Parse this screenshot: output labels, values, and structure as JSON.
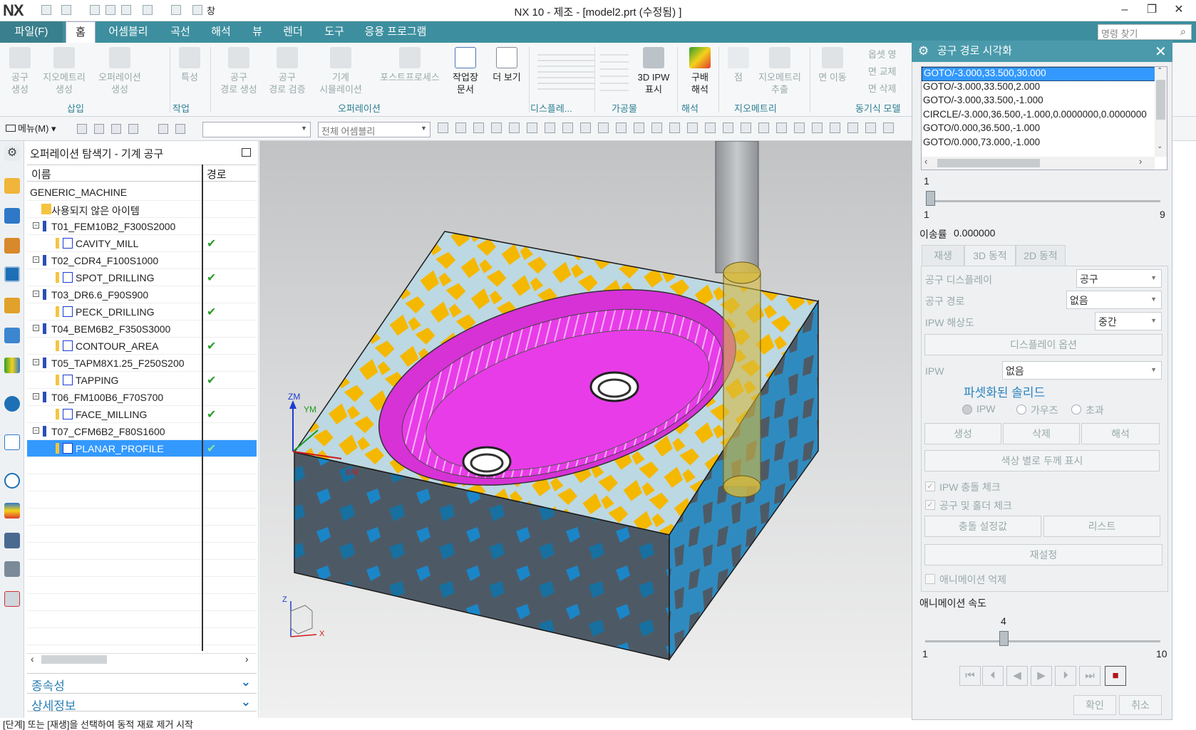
{
  "titlebar": {
    "logo": "NX",
    "window_menu": "창",
    "title": "NX 10 - 제조 - [model2.prt (수정됨) ]"
  },
  "ribbon_tabs": {
    "file": "파일(F)",
    "tabs": [
      "홈",
      "어셈블리",
      "곡선",
      "해석",
      "뷰",
      "렌더",
      "도구",
      "응용 프로그램"
    ],
    "command_search_placeholder": "명령 찾기"
  },
  "ribbon": {
    "insert": {
      "tool_create": "공구\n생성",
      "geometry_create": "지오메트리\n생성",
      "operation_create": "오퍼레이션\n생성",
      "group": "삽입"
    },
    "work": {
      "feature": "특성",
      "group": "작업"
    },
    "operation": {
      "generate_path": "공구\n경로 생성",
      "verify_path": "공구\n경로 검증",
      "machine_sim": "기계\n시뮬레이션",
      "postprocess": "포스트프로세스",
      "shop_doc": "작업장\n문서",
      "more": "더 보기",
      "group": "오퍼레이션"
    },
    "display": {
      "group": "디스플레..."
    },
    "workpiece": {
      "ipw_3d": "3D IPW\n표시",
      "group": "가공물"
    },
    "analysis": {
      "gradient": "구배\n해석",
      "group": "해석"
    },
    "geometry": {
      "point": "점",
      "extract": "지오메트리\n추출",
      "group": "지오메트리"
    },
    "sync": {
      "move_face": "면 이동",
      "offset_area": "옵셋 영",
      "replace_face": "면 교체",
      "delete_face": "면 삭제",
      "group": "동기식 모델"
    }
  },
  "toolbar2": {
    "menu": "메뉴(M)",
    "filter_value": "",
    "assembly_scope": "전체 어셈블리"
  },
  "navigator": {
    "title": "오퍼레이션 탐색기 - 기계 공구",
    "col_name": "이름",
    "col_path": "경로",
    "rows": [
      {
        "label": "GENERIC_MACHINE",
        "level": 0,
        "check": false
      },
      {
        "label": "사용되지 않은 아이템",
        "level": 1,
        "check": false
      },
      {
        "label": "T01_FEM10B2_F300S2000",
        "level": 1,
        "check": false
      },
      {
        "label": "CAVITY_MILL",
        "level": 2,
        "check": true
      },
      {
        "label": "T02_CDR4_F100S1000",
        "level": 1,
        "check": false
      },
      {
        "label": "SPOT_DRILLING",
        "level": 2,
        "check": true
      },
      {
        "label": "T03_DR6.6_F90S900",
        "level": 1,
        "check": false
      },
      {
        "label": "PECK_DRILLING",
        "level": 2,
        "check": true
      },
      {
        "label": "T04_BEM6B2_F350S3000",
        "level": 1,
        "check": false
      },
      {
        "label": "CONTOUR_AREA",
        "level": 2,
        "check": true
      },
      {
        "label": "T05_TAPM8X1.25_F250S200",
        "level": 1,
        "check": false
      },
      {
        "label": "TAPPING",
        "level": 2,
        "check": true
      },
      {
        "label": "T06_FM100B6_F70S700",
        "level": 1,
        "check": false
      },
      {
        "label": "FACE_MILLING",
        "level": 2,
        "check": true
      },
      {
        "label": "T07_CFM6B2_F80S1600",
        "level": 1,
        "check": false
      },
      {
        "label": "PLANAR_PROFILE",
        "level": 2,
        "check": true,
        "selected": true
      }
    ],
    "dependencies": "종속성",
    "details": "상세정보"
  },
  "viewport": {
    "triad_zm": "ZM",
    "triad_ym": "YM",
    "triad_xm": "XM",
    "triad_z": "Z",
    "triad_x": "X"
  },
  "status_bar": "[단계] 또는 [재생]을 선택하여 동적 재료 제거 시작",
  "dialog": {
    "title": "공구 경로 시각화",
    "cl_lines": [
      "GOTO/-3.000,33.500,30.000",
      "GOTO/-3.000,33.500,2.000",
      "GOTO/-3.000,33.500,-1.000",
      "CIRCLE/-3.000,36.500,-1.000,0.0000000,0.0000000",
      "GOTO/0.000,36.500,-1.000",
      "GOTO/0.000,73.000,-1.000"
    ],
    "step_slider": {
      "value": "1",
      "min": "1",
      "max": "9"
    },
    "feed_label": "이송률",
    "feed_value": "0.000000",
    "tabs": [
      "재생",
      "3D 동적",
      "2D 동적"
    ],
    "tool_display_label": "공구 디스플레이",
    "tool_display_value": "공구",
    "tool_path_label": "공구 경로",
    "tool_path_value": "없음",
    "ipw_res_label": "IPW 해상도",
    "ipw_res_value": "중간",
    "display_options": "디스플레이 옵션",
    "ipw_label": "IPW",
    "ipw_value": "없음",
    "faceted_solid": "파셋화된 솔리드",
    "radio_ipw": "IPW",
    "radio_gouge": "가우즈",
    "radio_excess": "초과",
    "btn_create": "생성",
    "btn_delete": "삭제",
    "btn_analyze": "해석",
    "btn_color_thickness": "색상 별로 두께 표시",
    "chk_ipw_collision": "IPW 충돌 체크",
    "chk_tool_holder": "공구 및 홀더 체크",
    "btn_collision_settings": "충돌 설정값",
    "btn_list": "리스트",
    "btn_reset": "재설정",
    "chk_suppress_anim": "애니메이션 억제",
    "anim_speed_label": "애니메이션 속도",
    "anim_slider": {
      "value": "4",
      "min": "1",
      "max": "10",
      "fraction": 0.333
    },
    "ok": "확인",
    "cancel": "취소"
  },
  "colors": {
    "ribbon_teal": "#3d8f9f",
    "selection_blue": "#3399ff",
    "check_green": "#2a9d2a",
    "stock_slate": "#4d5a66",
    "stock_blue": "#1a86c8",
    "gouge_yellow": "#f5b800",
    "pocket_magenta": "#e83ce8"
  }
}
